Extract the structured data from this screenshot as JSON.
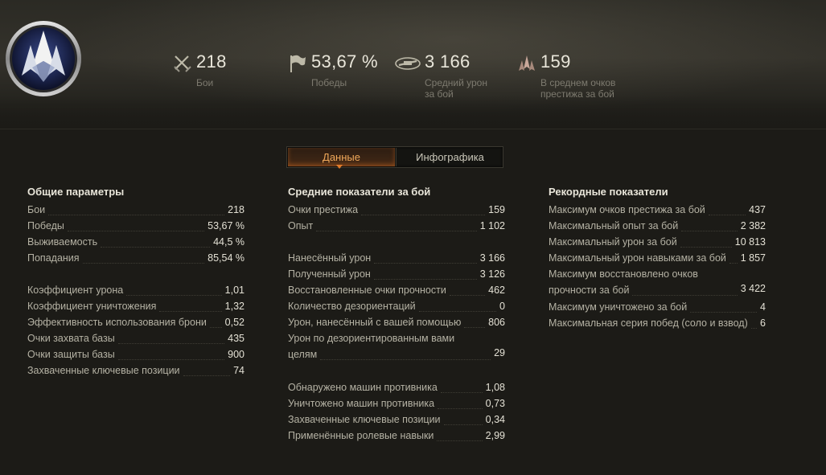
{
  "header": {
    "stats": [
      {
        "icon": "crossed-swords-icon",
        "value": "218",
        "label": "Бои"
      },
      {
        "icon": "flag-icon",
        "value": "53,67 %",
        "label": "Победы"
      },
      {
        "icon": "tank-damage-icon",
        "value": "3 166",
        "label": "Средний урон за бой"
      },
      {
        "icon": "prestige-chevron-icon",
        "value": "159",
        "label": "В среднем очков престижа за бой"
      }
    ]
  },
  "tabs": {
    "data": "Данные",
    "infographic": "Инфографика"
  },
  "general": {
    "title": "Общие параметры",
    "rows": [
      {
        "k": "Бои",
        "v": "218"
      },
      {
        "k": "Победы",
        "v": "53,67 %"
      },
      {
        "k": "Выживаемость",
        "v": "44,5 %"
      },
      {
        "k": "Попадания",
        "v": "85,54 %"
      },
      {
        "k": "Коэффициент урона",
        "v": "1,01"
      },
      {
        "k": "Коэффициент уничтожения",
        "v": "1,32"
      },
      {
        "k": "Эффективность использования брони",
        "v": "0,52"
      },
      {
        "k": "Очки захвата базы",
        "v": "435"
      },
      {
        "k": "Очки защиты базы",
        "v": "900"
      },
      {
        "k": "Захваченные ключевые позиции",
        "v": "74"
      }
    ]
  },
  "average": {
    "title": "Средние показатели за бой",
    "rows": [
      {
        "k": "Очки престижа",
        "v": "159"
      },
      {
        "k": "Опыт",
        "v": "1 102"
      },
      {
        "k": "Нанесённый урон",
        "v": "3 166"
      },
      {
        "k": "Полученный урон",
        "v": "3 126"
      },
      {
        "k": "Восстановленные очки прочности",
        "v": "462"
      },
      {
        "k": "Количество дезориентаций",
        "v": "0"
      },
      {
        "k": "Урон, нанесённый с вашей помощью",
        "v": "806"
      },
      {
        "k1": "Урон по дезориентированным вами",
        "k2": "целям",
        "v": "29"
      },
      {
        "k": "Обнаружено машин противника",
        "v": "1,08"
      },
      {
        "k": "Уничтожено машин противника",
        "v": "0,73"
      },
      {
        "k": "Захваченные ключевые позиции",
        "v": "0,34"
      },
      {
        "k": "Применённые ролевые навыки",
        "v": "2,99"
      }
    ]
  },
  "records": {
    "title": "Рекордные показатели",
    "rows": [
      {
        "k": "Максимум очков престижа за бой",
        "v": "437"
      },
      {
        "k": "Максимальный опыт за бой",
        "v": "2 382"
      },
      {
        "k": "Максимальный урон за бой",
        "v": "10 813"
      },
      {
        "k": "Максимальный урон навыками за бой",
        "v": "1 857"
      },
      {
        "k1": "Максимум восстановлено очков",
        "k2": "прочности за бой",
        "v": "3 422"
      },
      {
        "k": "Максимум уничтожено за бой",
        "v": "4"
      },
      {
        "k": "Максимальная серия побед (соло и взвод)",
        "v": "6"
      }
    ]
  }
}
